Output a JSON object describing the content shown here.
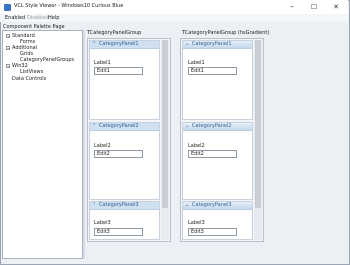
{
  "window": {
    "title": "VCL Style Viewer - Windows10 Curious Blue",
    "minimize": "–",
    "maximize": "☐",
    "close": "✕"
  },
  "menu": [
    "Enabled",
    "Disabled",
    "Help"
  ],
  "sidebar": {
    "caption": "Component Palette Page",
    "tree": [
      {
        "label": "Standard",
        "expander": "−"
      },
      {
        "label": "Forms"
      },
      {
        "label": "Additional",
        "expander": "−"
      },
      {
        "label": "Grids"
      },
      {
        "label": "CategoryPanelGroups"
      },
      {
        "label": "Win32",
        "expander": "−"
      },
      {
        "label": "ListViews"
      },
      {
        "label": "Data Controls"
      }
    ]
  },
  "groups": [
    {
      "caption": "TCategoryPanelGroup",
      "panels": [
        {
          "title": "CategoryPanel1",
          "chevron": "⌃",
          "label": "Label1",
          "edit": "Edit1"
        },
        {
          "title": "CategoryPanel2",
          "chevron": "⌃",
          "label": "Label2",
          "edit": "Edit2"
        },
        {
          "title": "CategoryPanel3",
          "chevron": "⌃",
          "label": "Label3",
          "edit": "Edit3"
        }
      ]
    },
    {
      "caption": "TCategoryPanelGroup (hsGradient)",
      "panels": [
        {
          "title": "CategoryPanel1",
          "chevron": "⌄",
          "label": "Label1",
          "edit": "Edit1"
        },
        {
          "title": "CategoryPanel2",
          "chevron": "⌄",
          "label": "Label2",
          "edit": "Edit2"
        },
        {
          "title": "CategoryPanel3",
          "chevron": "⌄",
          "label": "Label3",
          "edit": "Edit3"
        }
      ]
    }
  ]
}
